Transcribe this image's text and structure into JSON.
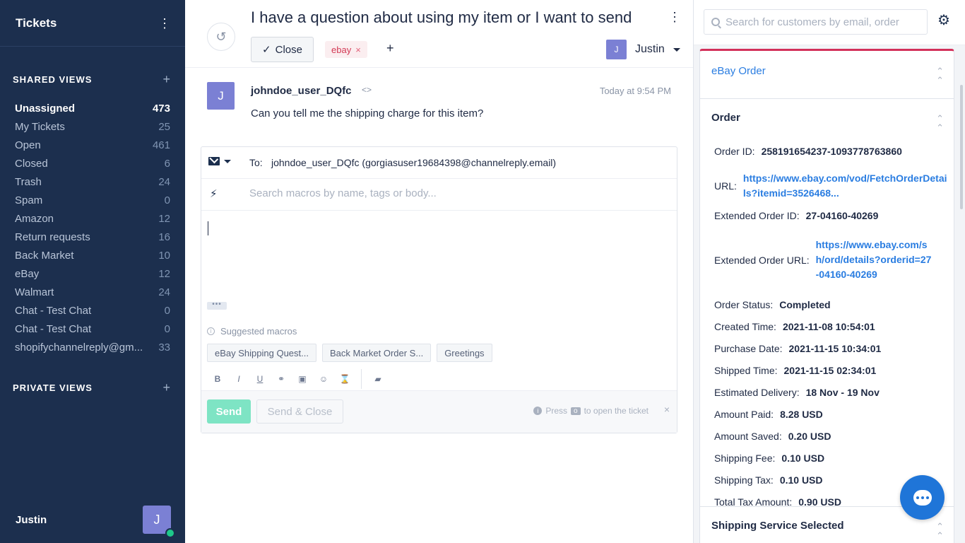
{
  "sidebar": {
    "title": "Tickets",
    "shared_views_label": "SHARED VIEWS",
    "private_views_label": "PRIVATE VIEWS",
    "views": [
      {
        "label": "Unassigned",
        "count": "473",
        "active": true
      },
      {
        "label": "My Tickets",
        "count": "25"
      },
      {
        "label": "Open",
        "count": "461"
      },
      {
        "label": "Closed",
        "count": "6"
      },
      {
        "label": "Trash",
        "count": "24"
      },
      {
        "label": "Spam",
        "count": "0"
      },
      {
        "label": "Amazon",
        "count": "12"
      },
      {
        "label": "Return requests",
        "count": "16"
      },
      {
        "label": "Back Market",
        "count": "10"
      },
      {
        "label": "eBay",
        "count": "12"
      },
      {
        "label": "Walmart",
        "count": "24"
      },
      {
        "label": "Chat - Test Chat",
        "count": "0"
      },
      {
        "label": "Chat - Test Chat",
        "count": "0"
      },
      {
        "label": "shopifychannelreply@gm...",
        "count": "33"
      }
    ],
    "user_name": "Justin",
    "user_initial": "J"
  },
  "ticket": {
    "subject": "I have a question about using my item or I want to send",
    "close_label": "Close",
    "tag_label": "ebay",
    "add_tag": "+",
    "assignee_initial": "J",
    "assignee_name": "Justin"
  },
  "message": {
    "author_initial": "J",
    "author": "johndoe_user_DQfc",
    "code_icon": "<>",
    "time": "Today at 9:54 PM",
    "body": "Can you tell me the shipping charge for this item?"
  },
  "composer": {
    "to_label": "To:",
    "to_value": "johndoe_user_DQfc (gorgiasuser19684398@channelreply.email)",
    "macro_placeholder": "Search macros by name, tags or body...",
    "suggested_label": "Suggested macros",
    "suggested": [
      "eBay Shipping Quest...",
      "Back Market Order S...",
      "Greetings"
    ],
    "send_label": "Send",
    "send_close_label": "Send & Close",
    "hint_pre": "Press",
    "hint_key": "o",
    "hint_post": "to open the ticket"
  },
  "right_panel": {
    "search_placeholder": "Search for customers by email, order",
    "ebay_card_title": "eBay Order",
    "order_card_title": "Order",
    "order_fields": [
      {
        "label": "Order ID:",
        "value": "258191654237-1093778763860"
      },
      {
        "label": "URL:",
        "value": "https://www.ebay.com/vod/FetchOrderDetails?itemid=3526468...",
        "link": true
      },
      {
        "label": "Extended Order ID:",
        "value": "27-04160-40269"
      },
      {
        "label": "Extended Order URL:",
        "value": "https://www.ebay.com/sh/ord/details?orderid=27-04160-40269",
        "link": true
      },
      {
        "label": "Order Status:",
        "value": "Completed"
      },
      {
        "label": "Created Time:",
        "value": "2021-11-08 10:54:01"
      },
      {
        "label": "Purchase Date:",
        "value": "2021-11-15 10:34:01"
      },
      {
        "label": "Shipped Time:",
        "value": "2021-11-15 02:34:01"
      },
      {
        "label": "Estimated Delivery:",
        "value": "18 Nov - 19 Nov"
      },
      {
        "label": "Amount Paid:",
        "value": "8.28 USD"
      },
      {
        "label": "Amount Saved:",
        "value": "0.20 USD"
      },
      {
        "label": "Shipping Fee:",
        "value": "0.10 USD"
      },
      {
        "label": "Shipping Tax:",
        "value": "0.10 USD"
      },
      {
        "label": "Total Tax Amount:",
        "value": "0.90 USD"
      }
    ],
    "shipping_card_title": "Shipping Service Selected"
  },
  "colors": {
    "sidebar_bg": "#1c2f4e",
    "accent_link": "#2a7de1",
    "tag_red": "#d33a55",
    "send_green": "#7ee4c4",
    "chat_blue": "#1f75d8",
    "online_green": "#1ec88a"
  }
}
